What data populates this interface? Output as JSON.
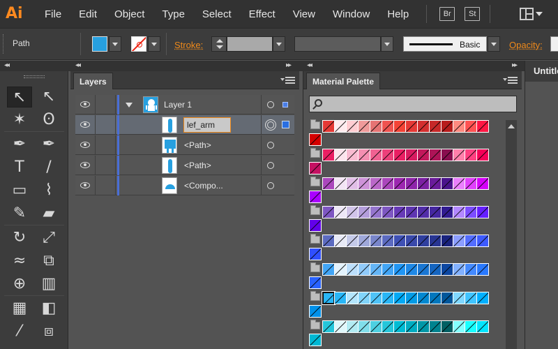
{
  "menubar": {
    "logo": "Ai",
    "items": [
      "File",
      "Edit",
      "Object",
      "Type",
      "Select",
      "Effect",
      "View",
      "Window",
      "Help"
    ],
    "bridge_label": "Br",
    "stock_label": "St"
  },
  "controlbar": {
    "selection_label": "Path",
    "stroke_label": "Stroke:",
    "brush_label": "Basic",
    "opacity_label": "Opacity:",
    "fill_color": "#27a0e0"
  },
  "tools": {
    "items": [
      {
        "name": "selection-tool",
        "glyph": "↖",
        "selected": true
      },
      {
        "name": "direct-selection-tool",
        "glyph": "↖"
      },
      {
        "name": "magic-wand-tool",
        "glyph": "✶"
      },
      {
        "name": "lasso-tool",
        "glyph": "ʘ"
      },
      {
        "name": "pen-tool",
        "glyph": "✒"
      },
      {
        "name": "curvature-tool",
        "glyph": "✒"
      },
      {
        "name": "type-tool",
        "glyph": "T"
      },
      {
        "name": "line-segment-tool",
        "glyph": "/"
      },
      {
        "name": "rectangle-tool",
        "glyph": "▭"
      },
      {
        "name": "paintbrush-tool",
        "glyph": "⌇"
      },
      {
        "name": "pencil-tool",
        "glyph": "✎"
      },
      {
        "name": "eraser-tool",
        "glyph": "▰"
      },
      {
        "name": "rotate-tool",
        "glyph": "↻"
      },
      {
        "name": "scale-tool",
        "glyph": "⤢"
      },
      {
        "name": "width-tool",
        "glyph": "≈"
      },
      {
        "name": "free-transform-tool",
        "glyph": "⧉"
      },
      {
        "name": "shape-builder-tool",
        "glyph": "⊕"
      },
      {
        "name": "graph-tool",
        "glyph": "▥"
      },
      {
        "name": "mesh-tool",
        "glyph": "▦"
      },
      {
        "name": "gradient-tool",
        "glyph": "◧"
      },
      {
        "name": "eyedropper-tool",
        "glyph": "⁄"
      },
      {
        "name": "blend-tool",
        "glyph": "⧈"
      }
    ]
  },
  "layers": {
    "tab_label": "Layers",
    "rows": [
      {
        "name": "Layer 1",
        "editing": false
      },
      {
        "name": "lef_arm",
        "editing": true
      },
      {
        "name": "<Path>",
        "editing": false
      },
      {
        "name": "<Path>",
        "editing": false
      },
      {
        "name": "<Compo...",
        "editing": false
      }
    ]
  },
  "palette": {
    "tab_label": "Material Palette",
    "groups": [
      {
        "name": "red",
        "colors": [
          "#e53935",
          "#ffebee",
          "#ffcdd2",
          "#ef9a9a",
          "#e57373",
          "#ef5350",
          "#f44336",
          "#e53935",
          "#d32f2f",
          "#c62828",
          "#b71c1c",
          "#ff8a80",
          "#ff5252",
          "#ff1744",
          "#d50000"
        ]
      },
      {
        "name": "pink",
        "colors": [
          "#e91e63",
          "#fce4ec",
          "#f8bbd0",
          "#f48fb1",
          "#f06292",
          "#ec407a",
          "#e91e63",
          "#d81b60",
          "#c2185b",
          "#ad1457",
          "#880e4f",
          "#ff80ab",
          "#ff4081",
          "#f50057",
          "#c51162"
        ]
      },
      {
        "name": "purple",
        "colors": [
          "#ab47bc",
          "#f3e5f5",
          "#e1bee7",
          "#ce93d8",
          "#ba68c8",
          "#ab47bc",
          "#9c27b0",
          "#8e24aa",
          "#7b1fa2",
          "#6a1b9a",
          "#4a148c",
          "#ea80fc",
          "#e040fb",
          "#d500f9",
          "#aa00ff"
        ]
      },
      {
        "name": "deep-purple",
        "colors": [
          "#7e57c2",
          "#ede7f6",
          "#d1c4e9",
          "#b39ddb",
          "#9575cd",
          "#7e57c2",
          "#673ab7",
          "#5e35b1",
          "#512da8",
          "#4527a0",
          "#311b92",
          "#b388ff",
          "#7c4dff",
          "#651fff",
          "#6200ea"
        ]
      },
      {
        "name": "indigo",
        "colors": [
          "#5c6bc0",
          "#e8eaf6",
          "#c5cae9",
          "#9fa8da",
          "#7986cb",
          "#5c6bc0",
          "#3f51b5",
          "#3949ab",
          "#303f9f",
          "#283593",
          "#1a237e",
          "#8c9eff",
          "#536dfe",
          "#3d5afe",
          "#304ffe"
        ]
      },
      {
        "name": "blue",
        "colors": [
          "#42a5f5",
          "#e3f2fd",
          "#bbdefb",
          "#90caf9",
          "#64b5f6",
          "#42a5f5",
          "#2196f3",
          "#1e88e5",
          "#1976d2",
          "#1565c0",
          "#0d47a1",
          "#82b1ff",
          "#448aff",
          "#2979ff",
          "#2962ff"
        ]
      },
      {
        "name": "light-blue",
        "colors": [
          "#29b6f6",
          "#29b6f6",
          "#b3e5fc",
          "#81d4fa",
          "#4fc3f7",
          "#29b6f6",
          "#03a9f4",
          "#039be5",
          "#0288d1",
          "#0277bd",
          "#01579b",
          "#80d8ff",
          "#40c4ff",
          "#00b0ff",
          "#0091ea"
        ]
      },
      {
        "name": "cyan",
        "colors": [
          "#26c6da",
          "#e0f7fa",
          "#b2ebf2",
          "#80deea",
          "#4dd0e1",
          "#26c6da",
          "#00bcd4",
          "#00acc1",
          "#0097a7",
          "#00838f",
          "#006064",
          "#84ffff",
          "#18ffff",
          "#00e5ff",
          "#00b8d4"
        ]
      }
    ],
    "highlighted_swatch": {
      "group": 6,
      "index": 0
    }
  },
  "document": {
    "tab_label": "Untitled"
  }
}
